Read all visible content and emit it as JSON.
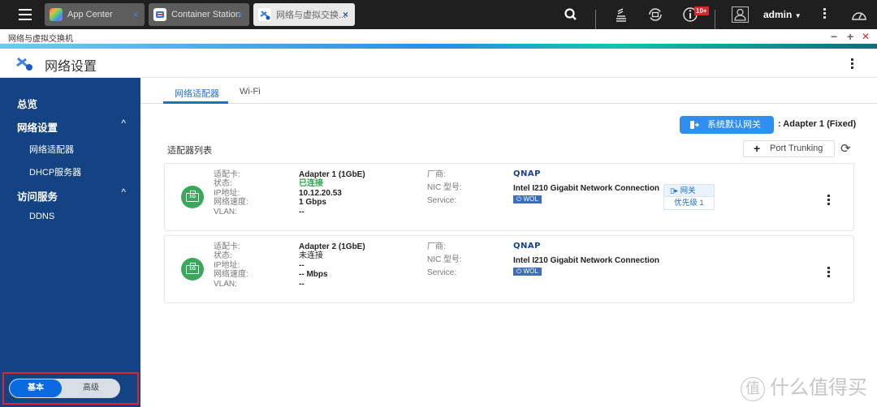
{
  "taskbar": {
    "tabs": [
      {
        "label": "App Center",
        "icon": "app-center-icon",
        "active": false
      },
      {
        "label": "Container Station",
        "icon": "container-station-icon",
        "active": false
      },
      {
        "label": "网络与虚拟交换...",
        "icon": "network-switch-icon",
        "active": true
      }
    ],
    "notification_badge": "10+",
    "user": "admin",
    "close_glyph": "×"
  },
  "window": {
    "title": "网络与虚拟交换机",
    "minimize": "−",
    "maximize": "+",
    "close": "✕"
  },
  "app": {
    "title": "网络设置"
  },
  "sidebar": {
    "items": [
      {
        "label": "总览",
        "type": "group"
      },
      {
        "label": "网络设置",
        "type": "group",
        "expanded": true
      },
      {
        "label": "网络适配器",
        "type": "sub"
      },
      {
        "label": "DHCP服务器",
        "type": "sub"
      },
      {
        "label": "访问服务",
        "type": "group",
        "expanded": true
      },
      {
        "label": "DDNS",
        "type": "sub"
      }
    ],
    "chevron": "^",
    "mode_toggle": {
      "on": "基本",
      "off": "高级"
    }
  },
  "main": {
    "tabs": [
      {
        "label": "网络适配器",
        "active": true
      },
      {
        "label": "Wi-Fi",
        "active": false
      }
    ],
    "default_gateway_button": "系统默认网关",
    "default_gateway_value": ": Adapter 1 (Fixed)",
    "list_title": "适配器列表",
    "port_trunking_button": "Port Trunking",
    "field_labels": [
      "适配卡:",
      "状态:",
      "IP地址:",
      "网络速度:",
      "VLAN:"
    ],
    "field_labels_right": [
      "厂商:",
      "NIC 型号:",
      "Service:"
    ],
    "adapters": [
      {
        "badge": "1G",
        "name": "Adapter 1 (1GbE)",
        "status": "已连接",
        "ip": "10.12.20.53",
        "speed": "1 Gbps",
        "vlan": "--",
        "vendor": "QNAP",
        "nic_model": "Intel I210 Gigabit Network Connection",
        "service": "⏻ WOL",
        "gateway_tag": "网关",
        "priority": "优先级 1"
      },
      {
        "badge": "1G",
        "name": "Adapter 2 (1GbE)",
        "status": "未连接",
        "ip": "--",
        "speed": "-- Mbps",
        "vlan": "--",
        "vendor": "QNAP",
        "nic_model": "Intel I210 Gigabit Network Connection",
        "service": "⏻ WOL"
      }
    ]
  },
  "watermark": {
    "circle": "值",
    "text": "什么值得买"
  }
}
